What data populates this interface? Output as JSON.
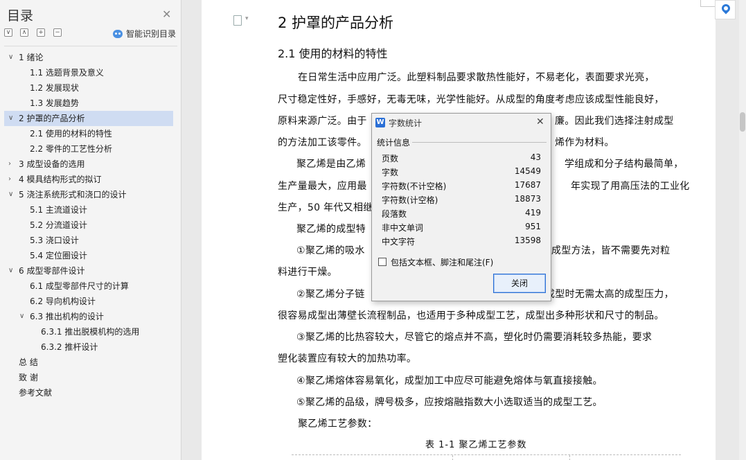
{
  "toc": {
    "title": "目录",
    "smart_label": "智能识别目录",
    "tool_buttons": [
      "∨",
      "∧",
      "+",
      "−"
    ],
    "items": [
      {
        "label": "1 绪论",
        "level": 1,
        "expanded": true
      },
      {
        "label": "1.1  选题背景及意义",
        "level": 2
      },
      {
        "label": "1.2  发展现状",
        "level": 2
      },
      {
        "label": "1.3  发展趋势",
        "level": 2
      },
      {
        "label": "2 护罩的产品分析",
        "level": 1,
        "expanded": true,
        "selected": true
      },
      {
        "label": "2.1 使用的材料的特性",
        "level": 2
      },
      {
        "label": "2.2 零件的工艺性分析",
        "level": 2
      },
      {
        "label": "3 成型设备的选用",
        "level": 1,
        "expanded": false
      },
      {
        "label": "4 模具结构形式的拟订",
        "level": 1,
        "expanded": false
      },
      {
        "label": "5 浇注系统形式和浇口的设计",
        "level": 1,
        "expanded": true
      },
      {
        "label": "5.1 主流道设计",
        "level": 2
      },
      {
        "label": "5.2 分流道设计",
        "level": 2
      },
      {
        "label": "5.3 浇口设计",
        "level": 2
      },
      {
        "label": "5.4 定位圈设计",
        "level": 2
      },
      {
        "label": "6 成型零部件设计",
        "level": 1,
        "expanded": true
      },
      {
        "label": "6.1 成型零部件尺寸的计算",
        "level": 2
      },
      {
        "label": "6.2 导向机构设计",
        "level": 2
      },
      {
        "label": "6.3 推出机构的设计",
        "level": 2,
        "expanded": true
      },
      {
        "label": "6.3.1 推出脱模机构的选用",
        "level": 3
      },
      {
        "label": "6.3.2 推杆设计",
        "level": 3
      },
      {
        "label": "总   结",
        "level": 0
      },
      {
        "label": "致  谢",
        "level": 0
      },
      {
        "label": "参考文献",
        "level": 0
      }
    ]
  },
  "document": {
    "heading1": "2 护罩的产品分析",
    "heading2": "2.1 使用的材料的特性",
    "lines": [
      "在日常生活中应用广泛。此塑料制品要求散热性能好，不易老化，表面要求光亮，",
      "尺寸稳定性好，手感好，无毒无味，光学性能好。从成型的角度考虑应该成型性能良好，",
      "原料来源广泛。由于",
      "廉。因此我们选择注射成型",
      "的方法加工该零件。",
      "烯作为材料。",
      "聚乙烯是由乙烯",
      "学组成和分子结构最简单，",
      "生产量最大，应用最",
      "年实现了用高压法的工业化",
      "生产，50 年代又相继",
      "聚乙烯的成型特",
      "①聚乙烯的吸水",
      "成型方法，皆不需要先对粒",
      "料进行干燥。",
      "②聚乙烯分子链",
      "成型时无需太高的成型压力，",
      "很容易成型出薄壁长流程制品，也适用于多种成型工艺，成型出多种形状和尺寸的制品。",
      "③聚乙烯的比热容较大，尽管它的熔点并不高，塑化时仍需要消耗较多热能，要求",
      "塑化装置应有较大的加热功率。",
      "④聚乙烯熔体容易氧化，成型加工中应尽可能避免熔体与氧直接接触。",
      "⑤聚乙烯的品级，牌号极多，应按熔融指数大小选取适当的成型工艺。",
      "聚乙烯工艺参数："
    ],
    "caption": "表 1-1  聚乙烯工艺参数"
  },
  "dialog": {
    "title": "字数统计",
    "group_label": "统计信息",
    "stats": [
      {
        "key": "页数",
        "value": "43"
      },
      {
        "key": "字数",
        "value": "14549"
      },
      {
        "key": "字符数(不计空格)",
        "value": "17687"
      },
      {
        "key": "字符数(计空格)",
        "value": "18873"
      },
      {
        "key": "段落数",
        "value": "419"
      },
      {
        "key": "非中文单词",
        "value": "951"
      },
      {
        "key": "中文字符",
        "value": "13598"
      }
    ],
    "checkbox_label": "包括文本框、脚注和尾注(F)",
    "checkbox_checked": false,
    "close_label": "关闭"
  },
  "colors": {
    "selection": "#cfdcf2",
    "accent": "#2a6fd6",
    "panel": "#f4f4f4"
  }
}
